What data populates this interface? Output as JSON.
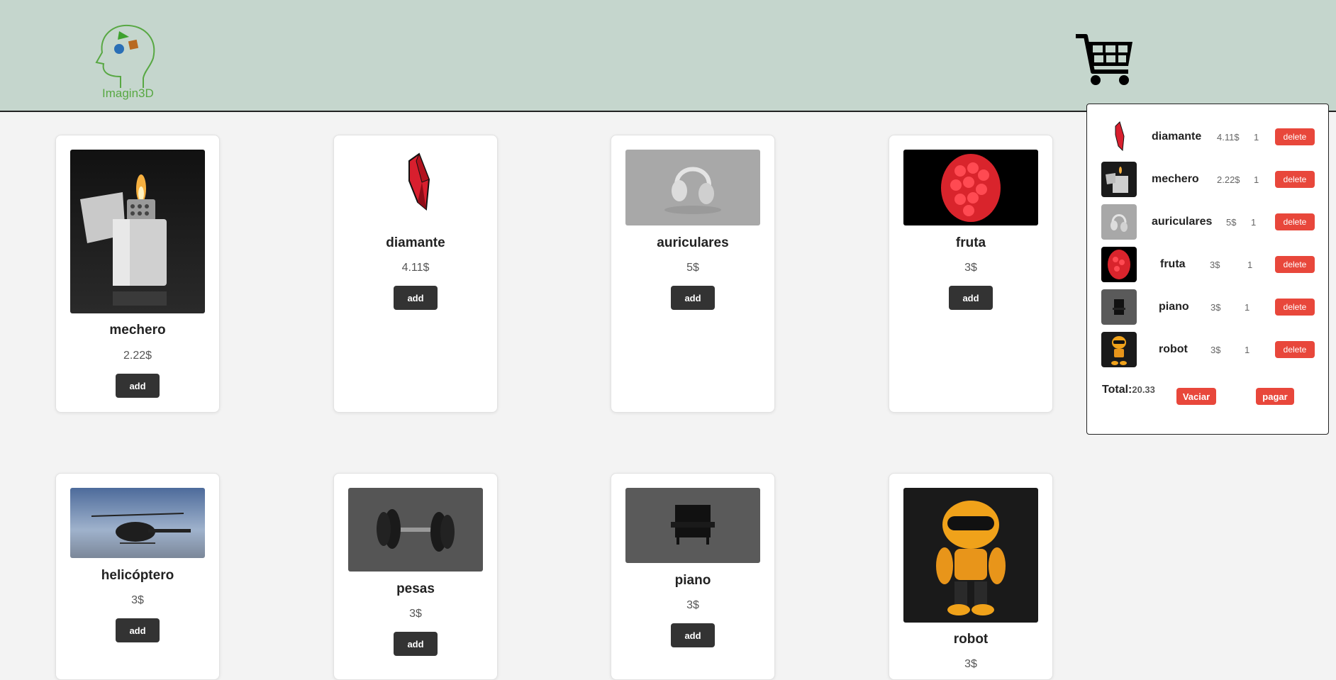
{
  "brand": {
    "logo_text": "Imagin3D"
  },
  "header": {
    "cart_icon": "shopping-cart-icon"
  },
  "products": [
    {
      "name": "mechero",
      "price": "2.22$",
      "add_label": "add"
    },
    {
      "name": "diamante",
      "price": "4.11$",
      "add_label": "add"
    },
    {
      "name": "auriculares",
      "price": "5$",
      "add_label": "add"
    },
    {
      "name": "fruta",
      "price": "3$",
      "add_label": "add"
    },
    {
      "name": "helicóptero",
      "price": "3$",
      "add_label": "add"
    },
    {
      "name": "pesas",
      "price": "3$",
      "add_label": "add"
    },
    {
      "name": "piano",
      "price": "3$",
      "add_label": "add"
    },
    {
      "name": "robot",
      "price": "3$"
    }
  ],
  "cart": {
    "items": [
      {
        "name": "diamante",
        "price": "4.11$",
        "qty": "1",
        "delete_label": "delete"
      },
      {
        "name": "mechero",
        "price": "2.22$",
        "qty": "1",
        "delete_label": "delete"
      },
      {
        "name": "auriculares",
        "price": "5$",
        "qty": "1",
        "delete_label": "delete"
      },
      {
        "name": "fruta",
        "price": "3$",
        "qty": "1",
        "delete_label": "delete"
      },
      {
        "name": "piano",
        "price": "3$",
        "qty": "1",
        "delete_label": "delete"
      },
      {
        "name": "robot",
        "price": "3$",
        "qty": "1",
        "delete_label": "delete"
      }
    ],
    "total_label": "Total:",
    "total_value": "20.33",
    "empty_label": "Vaciar",
    "pay_label": "pagar"
  },
  "colors": {
    "header_bg": "#c5d6cd",
    "danger": "#e8473b",
    "dark_button": "#333333"
  }
}
